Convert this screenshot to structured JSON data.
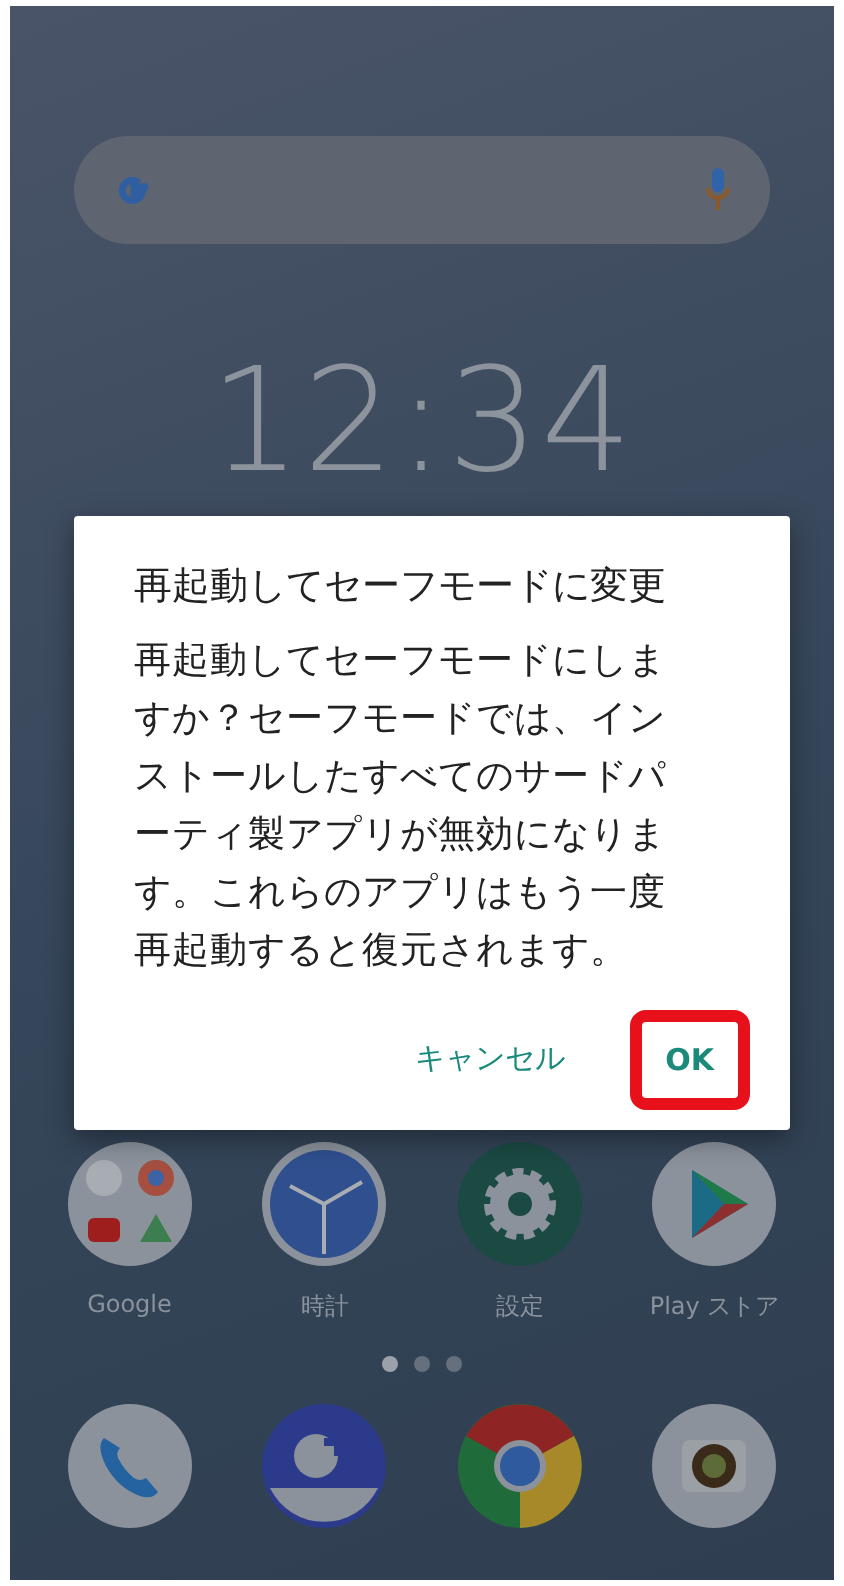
{
  "home_screen": {
    "clock": "12:34",
    "apps": [
      {
        "kind": "folder",
        "label": "Google"
      },
      {
        "kind": "clock",
        "label": "時計"
      },
      {
        "kind": "settings",
        "label": "設定"
      },
      {
        "kind": "play",
        "label": "Play ストア"
      }
    ],
    "page_dots": [
      {
        "selected": true
      },
      {
        "selected": false
      },
      {
        "selected": false
      }
    ],
    "dock": [
      {
        "kind": "phone"
      },
      {
        "kind": "message"
      },
      {
        "kind": "chrome"
      },
      {
        "kind": "camera"
      }
    ]
  },
  "dialog": {
    "title": "再起動してセーフモードに変更",
    "message": "再起動してセーフモードにしますか？セーフモードでは、インストールしたすべてのサードパーティ製アプリが無効になります。これらのアプリはもう一度再起動すると復元されます。",
    "buttons": [
      {
        "label": "キャンセル",
        "highlighted": false
      },
      {
        "label": "OK",
        "highlighted": true
      }
    ]
  }
}
